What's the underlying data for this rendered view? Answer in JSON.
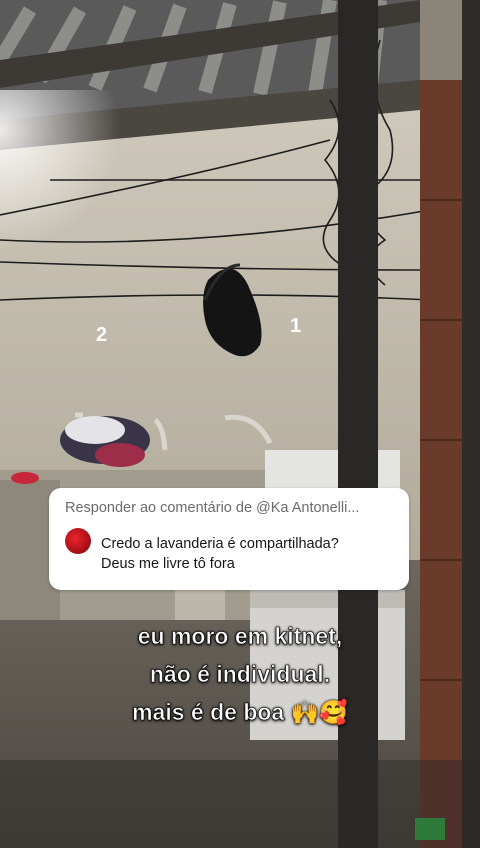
{
  "reply": {
    "header": "Responder ao comentário de @Ka Antonelli...",
    "line1": "Credo a lavanderia é compartilhada?",
    "line2": "Deus me livre tô fora"
  },
  "caption": {
    "line1": "eu moro em kitnet,",
    "line2": "não é individual.",
    "line3": "mais é de boa 🙌🥰"
  },
  "wall_marks": {
    "left": "2",
    "right": "1"
  }
}
